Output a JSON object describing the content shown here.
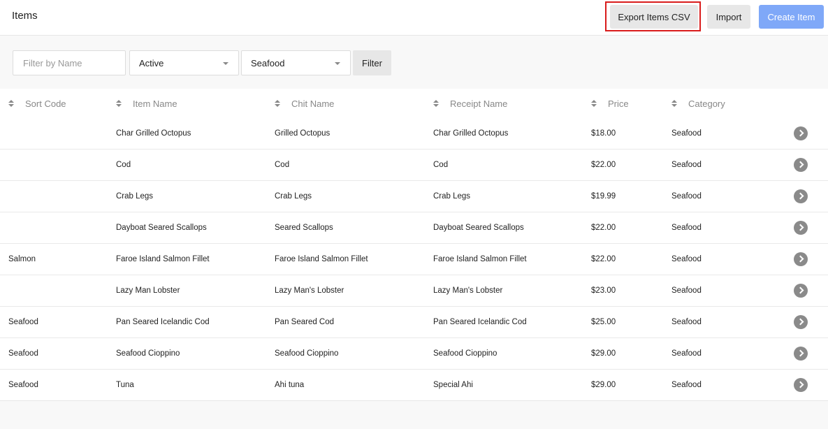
{
  "header": {
    "title": "Items",
    "export_label": "Export Items CSV",
    "import_label": "Import",
    "create_label": "Create Item",
    "highlight_color": "#d91c1c",
    "create_color": "#7fa8f8"
  },
  "filters": {
    "name_placeholder": "Filter by Name",
    "name_value": "",
    "status_value": "Active",
    "category_value": "Seafood",
    "filter_label": "Filter"
  },
  "table": {
    "columns": [
      "Sort Code",
      "Item Name",
      "Chit Name",
      "Receipt Name",
      "Price",
      "Category"
    ],
    "rows": [
      {
        "sort_code": "",
        "item_name": "Char Grilled Octopus",
        "chit_name": "Grilled Octopus",
        "receipt_name": "Char Grilled Octopus",
        "price": "$18.00",
        "category": "Seafood"
      },
      {
        "sort_code": "",
        "item_name": "Cod",
        "chit_name": "Cod",
        "receipt_name": "Cod",
        "price": "$22.00",
        "category": "Seafood"
      },
      {
        "sort_code": "",
        "item_name": "Crab Legs",
        "chit_name": "Crab Legs",
        "receipt_name": "Crab Legs",
        "price": "$19.99",
        "category": "Seafood"
      },
      {
        "sort_code": "",
        "item_name": "Dayboat Seared Scallops",
        "chit_name": "Seared Scallops",
        "receipt_name": "Dayboat Seared Scallops",
        "price": "$22.00",
        "category": "Seafood"
      },
      {
        "sort_code": "Salmon",
        "item_name": "Faroe Island Salmon Fillet",
        "chit_name": "Faroe Island Salmon Fillet",
        "receipt_name": "Faroe Island Salmon Fillet",
        "price": "$22.00",
        "category": "Seafood"
      },
      {
        "sort_code": "",
        "item_name": "Lazy Man Lobster",
        "chit_name": "Lazy Man's Lobster",
        "receipt_name": "Lazy Man's Lobster",
        "price": "$23.00",
        "category": "Seafood"
      },
      {
        "sort_code": "Seafood",
        "item_name": "Pan Seared Icelandic Cod",
        "chit_name": "Pan Seared Cod",
        "receipt_name": "Pan Seared Icelandic Cod",
        "price": "$25.00",
        "category": "Seafood"
      },
      {
        "sort_code": "Seafood",
        "item_name": "Seafood Cioppino",
        "chit_name": "Seafood Cioppino",
        "receipt_name": "Seafood Cioppino",
        "price": "$29.00",
        "category": "Seafood"
      },
      {
        "sort_code": "Seafood",
        "item_name": "Tuna",
        "chit_name": "Ahi tuna",
        "receipt_name": "Special Ahi",
        "price": "$29.00",
        "category": "Seafood"
      }
    ]
  }
}
